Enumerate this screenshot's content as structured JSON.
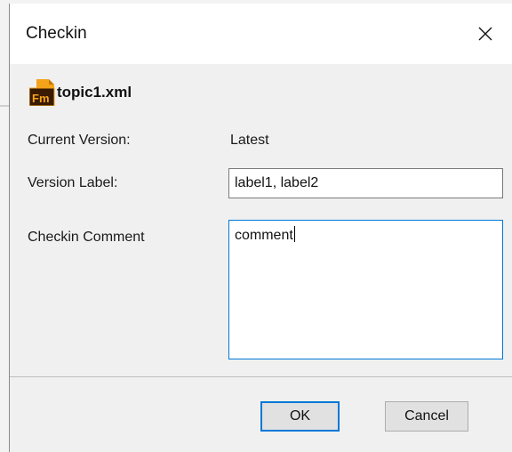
{
  "dialog": {
    "title": "Checkin",
    "close_icon": "close-icon"
  },
  "file": {
    "icon": "framemaker-file-icon",
    "icon_text": "Fm",
    "name": "topic1.xml"
  },
  "form": {
    "current_version_label": "Current Version:",
    "current_version_value": "Latest",
    "version_label_label": "Version Label:",
    "version_label_value": "label1, label2",
    "checkin_comment_label": "Checkin Comment",
    "checkin_comment_value": "comment"
  },
  "buttons": {
    "ok": "OK",
    "cancel": "Cancel"
  },
  "colors": {
    "accent": "#0078d7",
    "dialog_bg": "#f0f0f0",
    "icon_orange": "#f4a31a",
    "icon_dark": "#3a1a00"
  }
}
